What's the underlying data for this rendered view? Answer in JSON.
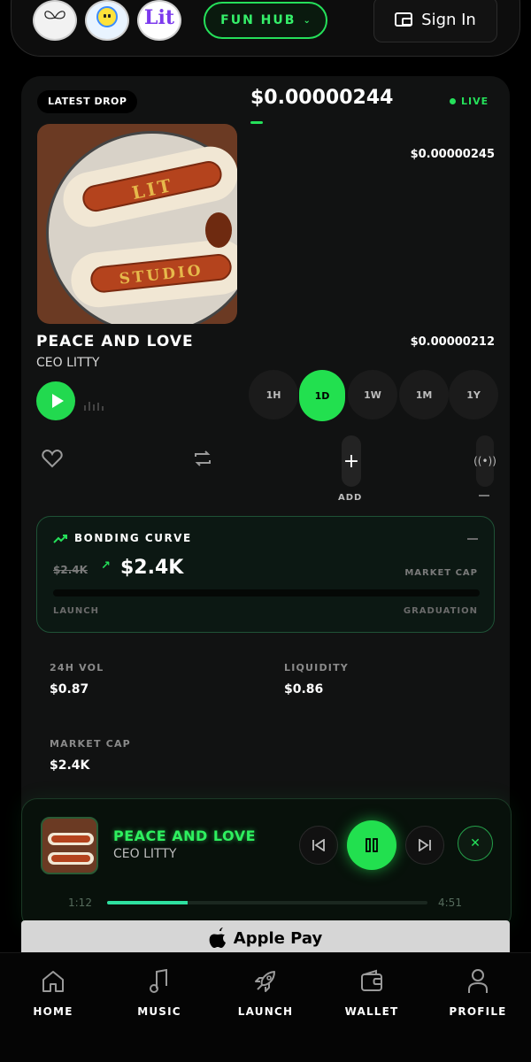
{
  "header": {
    "fun_hub_label": "FUN HUB",
    "sign_in_label": "Sign In",
    "logos": [
      "studio-logo",
      "smiley-logo",
      "lit-studio-logo"
    ],
    "lit_logo_text": "Lit"
  },
  "drop": {
    "badge": "LATEST DROP",
    "current_price": "$0.00000244",
    "live_label": "LIVE",
    "price_high": "$0.00000245",
    "price_low": "$0.00000212",
    "track_title": "PEACE AND LOVE",
    "artist": "CEO LITTY",
    "cover_text_1": "LIT",
    "cover_text_2": "STUDIO",
    "timeframes": [
      "1H",
      "1D",
      "1W",
      "1M",
      "1Y"
    ],
    "active_timeframe": "1D",
    "add_label": "ADD",
    "broadcast_label": "((•))"
  },
  "bonding_curve": {
    "title": "BONDING CURVE",
    "old_value": "$2.4K",
    "arrow": "↗",
    "value": "$2.4K",
    "value_caption": "MARKET CAP",
    "progress": 0,
    "start_label": "LAUNCH",
    "end_label": "GRADUATION"
  },
  "stats": {
    "vol_label": "24H VOL",
    "vol_value": "$0.87",
    "liq_label": "LIQUIDITY",
    "liq_value": "$0.86",
    "mc_label": "MARKET CAP",
    "mc_value": "$2.4K"
  },
  "player": {
    "title": "PEACE AND LOVE",
    "artist": "CEO LITTY",
    "current_time": "1:12",
    "total_time": "4:51",
    "progress": 0.25,
    "close_glyph": "✕"
  },
  "apple_pay": {
    "label": "Apple Pay",
    "glyph": ""
  },
  "nav": [
    {
      "label": "HOME",
      "icon": "home-icon"
    },
    {
      "label": "MUSIC",
      "icon": "music-note-icon"
    },
    {
      "label": "LAUNCH",
      "icon": "rocket-icon"
    },
    {
      "label": "WALLET",
      "icon": "wallet-icon"
    },
    {
      "label": "PROFILE",
      "icon": "profile-icon"
    }
  ],
  "colors": {
    "accent": "#25e05a",
    "background": "#000000",
    "card": "#111212"
  }
}
